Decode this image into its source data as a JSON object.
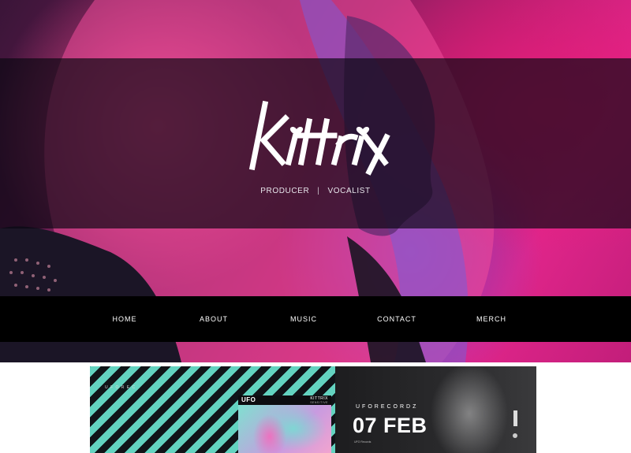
{
  "hero": {
    "logo_text": "Kittrix",
    "tagline": {
      "left": "PRODUCER",
      "separator": "|",
      "right": "VOCALIST"
    }
  },
  "nav": {
    "items": [
      {
        "label": "HOME"
      },
      {
        "label": "ABOUT"
      },
      {
        "label": "MUSIC"
      },
      {
        "label": "CONTACT"
      },
      {
        "label": "MERCH"
      }
    ]
  },
  "banner": {
    "small_brand": "U F O R E C",
    "album": {
      "ufo": "UFO",
      "artist": "KITTRIX",
      "sub": "SENSITIVE"
    },
    "label_name": "UFORECORDZ",
    "date": "07 FEB",
    "tiny_info": "UFO Records"
  },
  "colors": {
    "hero_pink": "#e0258a",
    "band": "#0a0812",
    "nav_bg": "#000000",
    "stripe_teal": "#63d3c0"
  }
}
